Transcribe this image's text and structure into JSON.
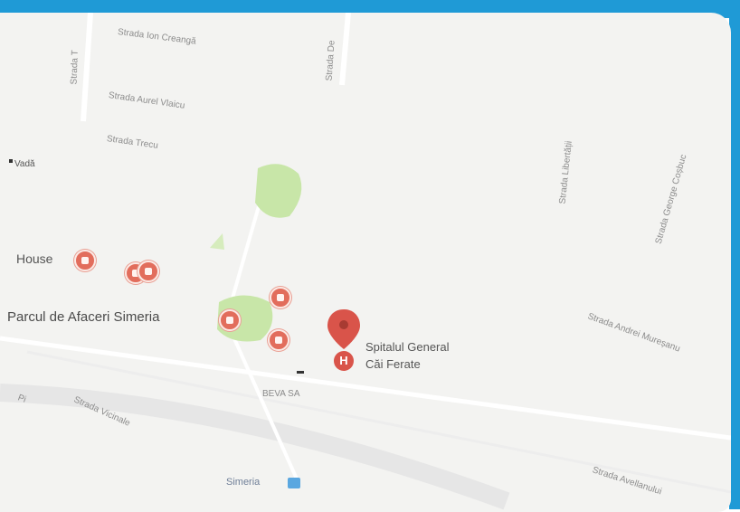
{
  "map": {
    "colors": {
      "frame": "#1f9ad6",
      "background": "#f3f3f1",
      "park": "#c8e6a8",
      "poi": "#e26d5c",
      "pin": "#d9544a",
      "station": "#5aa7e0"
    },
    "streets": {
      "ion_creanga": "Strada Ion Creangă",
      "left_vertical": "Strada T",
      "aurel_vlaicu": "Strada Aurel Vlaicu",
      "trecu": "Strada Trecu",
      "de_vertical": "Strada De",
      "libertatii": "Strada Libertății",
      "george_cosbuc": "Strada George Coșbuc",
      "avram_muresanu": "Strada Andrei Mureșanu",
      "vicinala": "Strada Vicinale",
      "avellanului": "Strada Avellanului",
      "fragment_left": "Pi"
    },
    "places": {
      "left_edge": "Vadă",
      "house": "House",
      "parc_afaceri": "Parcul de Afaceri Simeria",
      "hospital_line1": "Spitalul General",
      "hospital_line2": "Căi Ferate",
      "beva": "BEVA SA",
      "simeria": "Simeria"
    },
    "icons": {
      "hospital": "H"
    }
  }
}
